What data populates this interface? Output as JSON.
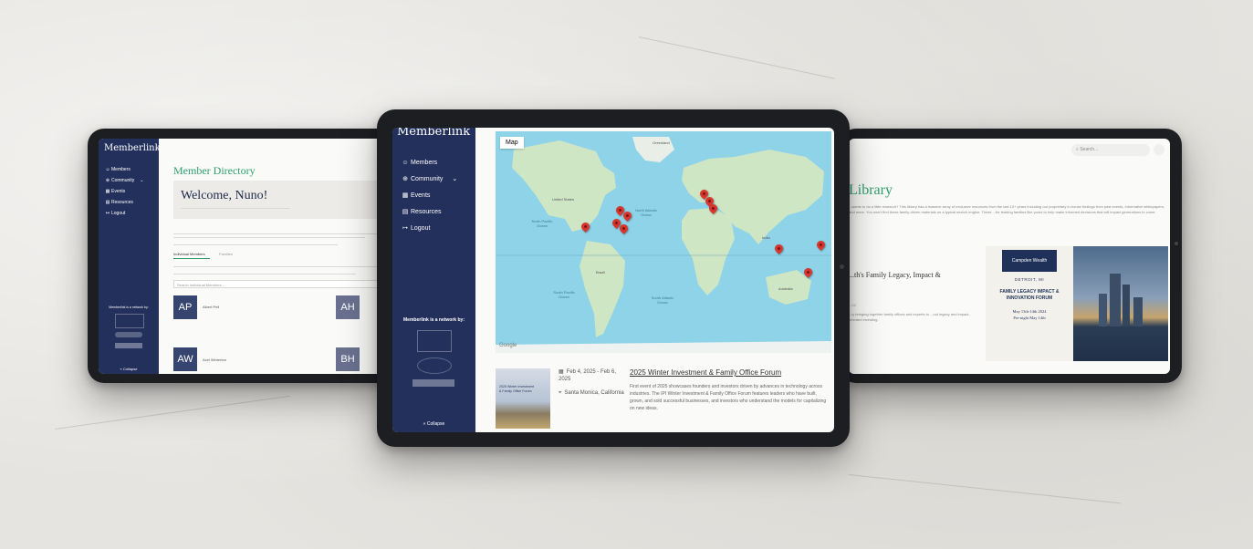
{
  "left_tablet": {
    "brand": "Memberlink",
    "nav": [
      {
        "icon": "person-icon",
        "label": "Members"
      },
      {
        "icon": "globe-icon",
        "label": "Community"
      },
      {
        "icon": "calendar-icon",
        "label": "Events"
      },
      {
        "icon": "book-icon",
        "label": "Resources"
      },
      {
        "icon": "logout-icon",
        "label": "Logout"
      }
    ],
    "sponsor_label": "Memberlink is a network by:",
    "collapse_label": "« Collapse",
    "page_title": "Member Directory",
    "welcome": "Welcome, Nuno!",
    "tabs": [
      "Individual Members",
      "Families"
    ],
    "search_placeholder": "Search Individual Members...",
    "members": [
      {
        "initials": "AP",
        "name": "Albert Pell"
      },
      {
        "initials": "AW",
        "name": "Axel Winterton"
      }
    ],
    "members_right": [
      {
        "initials": "AH"
      },
      {
        "initials": "BH"
      }
    ]
  },
  "center_tablet": {
    "brand": "Memberlink",
    "nav": [
      {
        "icon": "person-icon",
        "label": "Members"
      },
      {
        "icon": "globe-icon",
        "label": "Community"
      },
      {
        "icon": "calendar-icon",
        "label": "Events"
      },
      {
        "icon": "book-icon",
        "label": "Resources"
      },
      {
        "icon": "logout-icon",
        "label": "Logout"
      }
    ],
    "sponsor_label": "Memberlink is a network by:",
    "collapse_label": "« Collapse",
    "map_label": "Map",
    "map_places": {
      "greenland": "Greenland",
      "north_pacific": "North Pacific Ocean",
      "north_atlantic": "North Atlantic Ocean",
      "south_pacific": "South Pacific Ocean",
      "south_atlantic": "South Atlantic Ocean",
      "united_states": "United States",
      "brazil": "Brazil",
      "india": "India",
      "australia": "Australia"
    },
    "google_mark": "Google",
    "event": {
      "date": "Feb 4, 2025 - Feb 6, 2025",
      "location": "Santa Monica, California",
      "title": "2025 Winter Investment & Family Office Forum",
      "description": "First event of 2025 showcases founders and investors driven by advances in technology across industries. The IPI Winter Investment & Family Office Forum features leaders who have built, grown, and sold successful businesses, and investors who understand the models for capitalizing on new ideas.",
      "thumb_title": "2025 Winter Investment & Family Office Forum"
    }
  },
  "right_tablet": {
    "search_placeholder": "Search...",
    "page_title": "Library",
    "intro": "...wants to do a little research? This library has a massive array of exclusive resources from the last 10+ years including our proprietary in-house findings from past events, informative whitepapers, and more. You won't find these family-driven materials on a typical search engine. These ...for leading families like yours to help make informed decisions that will impact generations to come.",
    "resource_title": "...th's Family Legacy, Impact &",
    "resource_date": "...24",
    "resource_desc": "...ly bringing together family offices and experts to ...out legacy and impact-oriented investing.",
    "poster": {
      "brand": "Campden Wealth",
      "city": "DETROIT, MI",
      "forum": "FAMILY LEGACY IMPACT & INNOVATION FORUM",
      "dates": "May 13th-14th 2024",
      "preview": "Pre-night May 14th"
    }
  },
  "colors": {
    "sidebar": "#23305c",
    "accent_green": "#2e9e6e",
    "map_water": "#8fd3e8",
    "map_land": "#cfe6c4",
    "pin_red": "#d8352e"
  }
}
